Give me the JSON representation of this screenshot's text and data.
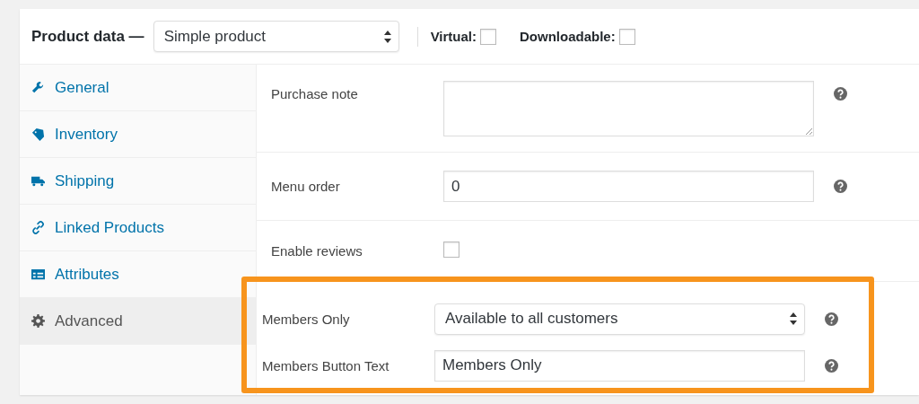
{
  "header": {
    "title": "Product data —",
    "product_type": "Simple product",
    "options": [
      {
        "label": "Virtual:",
        "checked": false
      },
      {
        "label": "Downloadable:",
        "checked": false
      }
    ]
  },
  "tabs": [
    {
      "label": "General",
      "selected": false
    },
    {
      "label": "Inventory",
      "selected": false
    },
    {
      "label": "Shipping",
      "selected": false
    },
    {
      "label": "Linked Products",
      "selected": false
    },
    {
      "label": "Attributes",
      "selected": false
    },
    {
      "label": "Advanced",
      "selected": true
    }
  ],
  "fields": [
    {
      "label": "Purchase note",
      "kind": "textarea",
      "highlighted": false
    },
    {
      "label": "Menu order",
      "kind": "text",
      "value": "0",
      "highlighted": false
    },
    {
      "label": "Enable reviews",
      "kind": "checkbox",
      "checked": false,
      "highlighted": false
    },
    {
      "label": "Members Only",
      "kind": "select",
      "value": "Available to all customers",
      "highlighted": true
    },
    {
      "label": "Members Button Text",
      "kind": "text",
      "value": "Members Only",
      "highlighted": true
    }
  ]
}
